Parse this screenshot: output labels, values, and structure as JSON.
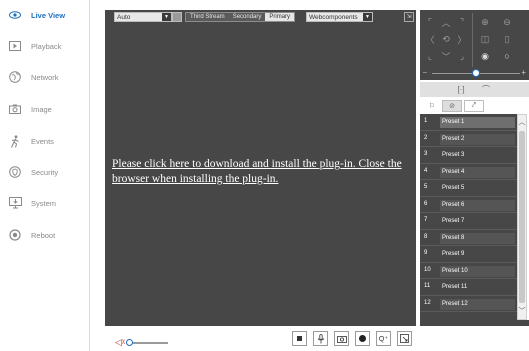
{
  "sidebar": {
    "items": [
      {
        "label": "Live View",
        "icon": "eye-icon",
        "active": true
      },
      {
        "label": "Playback",
        "icon": "playback-icon",
        "active": false
      },
      {
        "label": "Network",
        "icon": "globe-icon",
        "active": false
      },
      {
        "label": "Image",
        "icon": "camera-icon",
        "active": false
      },
      {
        "label": "Events",
        "icon": "running-person-icon",
        "active": false
      },
      {
        "label": "Security",
        "icon": "shield-icon",
        "active": false
      },
      {
        "label": "System",
        "icon": "monitor-icon",
        "active": false
      },
      {
        "label": "Reboot",
        "icon": "power-icon",
        "active": false
      }
    ]
  },
  "toolbar": {
    "mode_select": "Auto",
    "streams": [
      "Third Stream",
      "Secondary",
      "Primary"
    ],
    "active_stream": "Primary",
    "player_select": "Webcomponents"
  },
  "video": {
    "plugin_message": "Please click here to download and install the plug-in. Close the browser when installing the plug-in."
  },
  "ptz": {
    "speed_level": 0.5
  },
  "presets": [
    {
      "num": "1",
      "name": "Preset 1"
    },
    {
      "num": "2",
      "name": "Preset 2"
    },
    {
      "num": "3",
      "name": "Preset 3"
    },
    {
      "num": "4",
      "name": "Preset 4"
    },
    {
      "num": "5",
      "name": "Preset 5"
    },
    {
      "num": "6",
      "name": "Preset 6"
    },
    {
      "num": "7",
      "name": "Preset 7"
    },
    {
      "num": "8",
      "name": "Preset 8"
    },
    {
      "num": "9",
      "name": "Preset 9"
    },
    {
      "num": "10",
      "name": "Preset 10"
    },
    {
      "num": "11",
      "name": "Preset 11"
    },
    {
      "num": "12",
      "name": "Preset 12"
    }
  ],
  "colors": {
    "accent": "#1e6fbf",
    "video_bg": "#474747",
    "mute_icon": "#c0392b"
  }
}
